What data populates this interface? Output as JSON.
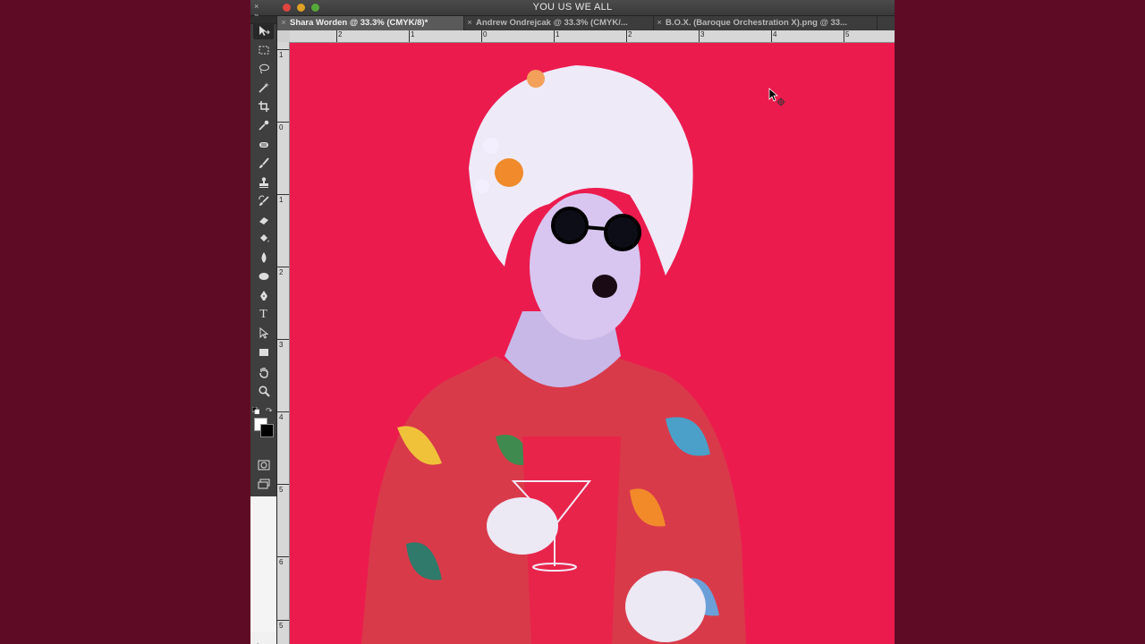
{
  "window": {
    "title": "YOU US WE ALL"
  },
  "panel_collapse": {
    "left": "×",
    "right": "»"
  },
  "tabs": [
    {
      "label": "Shara Worden  @ 33.3% (CMYK/8)*",
      "active": true
    },
    {
      "label": "Andrew Ondrejcak  @ 33.3% (CMYK/...",
      "active": false
    },
    {
      "label": "B.O.X. (Baroque Orchestration X).png  @ 33...",
      "active": false
    }
  ],
  "tab_close": "×",
  "tools": [
    {
      "name": "move-tool-icon",
      "selected": true
    },
    {
      "name": "marquee-tool-icon"
    },
    {
      "name": "lasso-tool-icon"
    },
    {
      "name": "magic-wand-tool-icon"
    },
    {
      "name": "crop-tool-icon"
    },
    {
      "name": "eyedropper-tool-icon"
    },
    {
      "name": "healing-brush-tool-icon"
    },
    {
      "name": "brush-tool-icon"
    },
    {
      "name": "clone-stamp-tool-icon"
    },
    {
      "name": "history-brush-tool-icon"
    },
    {
      "name": "eraser-tool-icon"
    },
    {
      "name": "paint-bucket-tool-icon"
    },
    {
      "name": "blur-tool-icon"
    },
    {
      "name": "dodge-tool-icon"
    },
    {
      "name": "pen-tool-icon"
    },
    {
      "name": "type-tool-icon"
    },
    {
      "name": "path-selection-tool-icon"
    },
    {
      "name": "rectangle-tool-icon"
    },
    {
      "name": "hand-tool-icon"
    },
    {
      "name": "zoom-tool-icon"
    }
  ],
  "type_tool_glyph": "T",
  "swap_glyph": "↷",
  "colors": {
    "foreground": "#ffffff",
    "background": "#000000",
    "canvas": "#ec1b4e"
  },
  "ruler_top": [
    "2",
    "1",
    "0",
    "1",
    "2",
    "3",
    "4",
    "5"
  ],
  "ruler_left": [
    "1",
    "0",
    "1",
    "2",
    "3",
    "4",
    "5",
    "6",
    "5"
  ],
  "panel_add_label": "+⌄"
}
